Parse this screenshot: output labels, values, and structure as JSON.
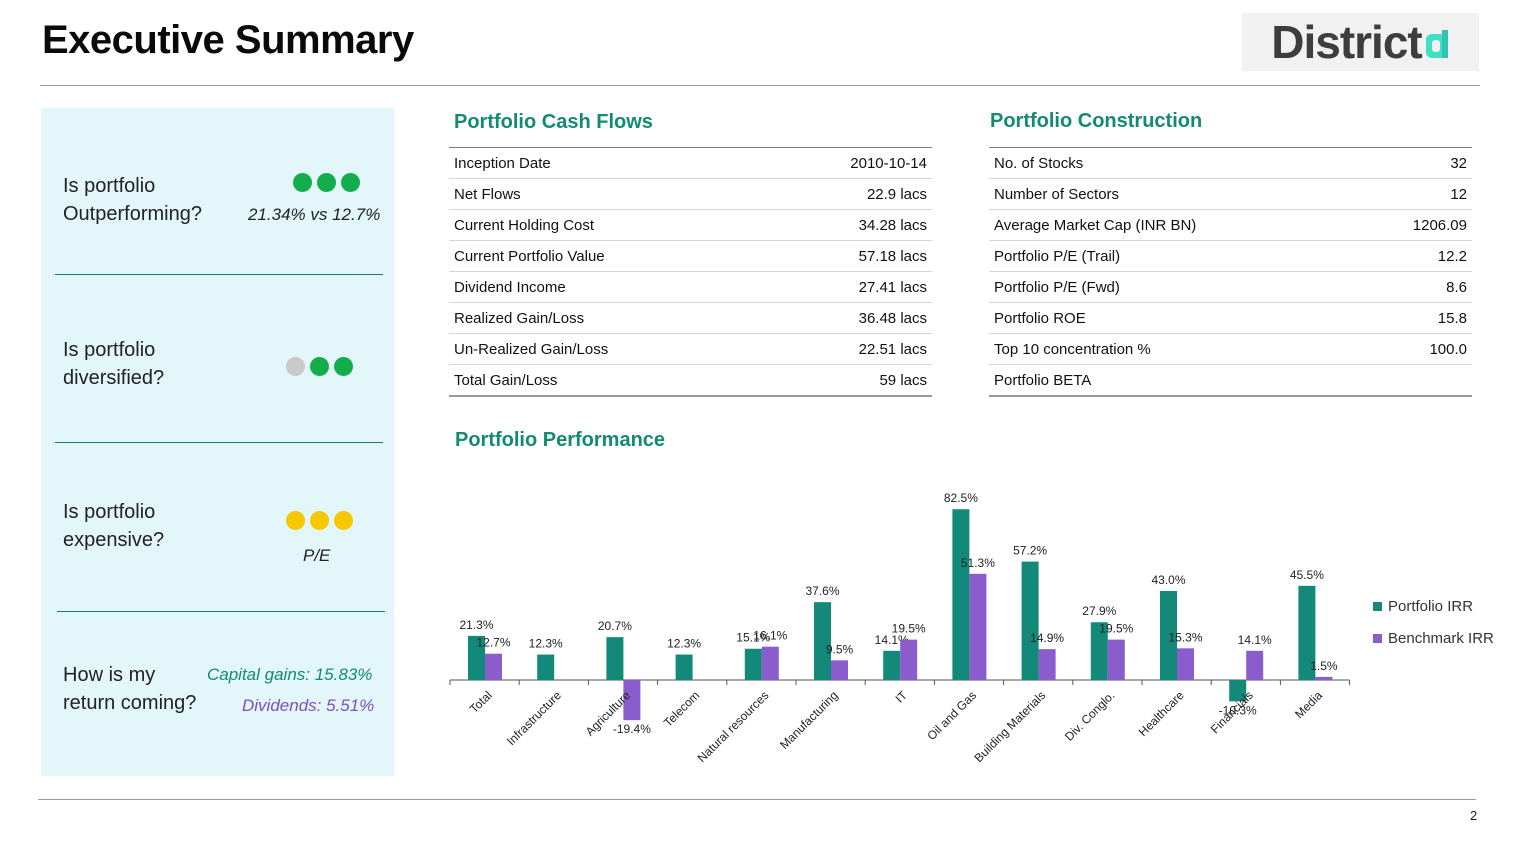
{
  "header": {
    "title": "Executive Summary",
    "logo_text": "District",
    "page_number": "2"
  },
  "colors": {
    "accent": "#138a73",
    "portfolio": "#13897a",
    "benchmark": "#8a5ccc",
    "dot_green": "#14ad4c",
    "dot_grey": "#c9c9c9",
    "dot_yellow": "#f5c802",
    "panel_bg": "#e3f6fa"
  },
  "summary": {
    "outperforming": {
      "question": "Is portfolio Outperforming?",
      "rating": [
        "green",
        "green",
        "green"
      ],
      "note": "21.34% vs 12.7%"
    },
    "diversified": {
      "question": "Is portfolio diversified?",
      "rating": [
        "grey",
        "green",
        "green"
      ]
    },
    "expensive": {
      "question": "Is portfolio expensive?",
      "rating": [
        "yellow",
        "yellow",
        "yellow"
      ],
      "note": "P/E"
    },
    "returns": {
      "question": "How is my return coming?",
      "capital_gains": "Capital gains: 15.83%",
      "dividends": "Dividends: 5.51%"
    }
  },
  "cash_flows": {
    "title": "Portfolio Cash Flows",
    "rows": [
      {
        "label": "Inception Date",
        "value": "2010-10-14"
      },
      {
        "label": "Net Flows",
        "value": "22.9 lacs"
      },
      {
        "label": "Current Holding Cost",
        "value": "34.28 lacs"
      },
      {
        "label": "Current Portfolio Value",
        "value": "57.18 lacs"
      },
      {
        "label": "Dividend Income",
        "value": "27.41 lacs"
      },
      {
        "label": "Realized Gain/Loss",
        "value": "36.48 lacs"
      },
      {
        "label": "Un-Realized Gain/Loss",
        "value": "22.51 lacs"
      },
      {
        "label": "Total Gain/Loss",
        "value": "59 lacs"
      }
    ]
  },
  "construction": {
    "title": "Portfolio Construction",
    "rows": [
      {
        "label": "No. of Stocks",
        "value": "32"
      },
      {
        "label": "Number of Sectors",
        "value": "12"
      },
      {
        "label": "Average Market Cap (INR BN)",
        "value": "1206.09"
      },
      {
        "label": "Portfolio P/E (Trail)",
        "value": "12.2"
      },
      {
        "label": "Portfolio P/E (Fwd)",
        "value": "8.6"
      },
      {
        "label": "Portfolio ROE",
        "value": "15.8"
      },
      {
        "label": "Top 10 concentration %",
        "value": "100.0"
      },
      {
        "label": "Portfolio BETA",
        "value": ""
      }
    ]
  },
  "performance": {
    "title": "Portfolio Performance"
  },
  "chart_data": {
    "type": "bar",
    "categories": [
      "Total",
      "Infrastructure",
      "Agriculture",
      "Telecom",
      "Natural resources",
      "Manufacturing",
      "IT",
      "Oil and Gas",
      "Building Materials",
      "Div. Conglo.",
      "Healthcare",
      "Financials",
      "Media"
    ],
    "series": [
      {
        "name": "Portfolio IRR",
        "values": [
          21.3,
          12.3,
          20.7,
          12.3,
          15.1,
          37.6,
          14.1,
          82.5,
          57.2,
          27.9,
          43.0,
          -10.3,
          45.5
        ],
        "labels": [
          "21.3%",
          "12.3%",
          "20.7%",
          "12.3%",
          "15.1%",
          "37.6%",
          "14.1%",
          "82.5%",
          "57.2%",
          "27.9%",
          "43.0%",
          "-10.3%",
          "45.5%"
        ]
      },
      {
        "name": "Benchmark IRR",
        "values": [
          12.7,
          null,
          -19.4,
          null,
          16.1,
          9.5,
          19.5,
          51.3,
          14.9,
          19.5,
          15.3,
          14.1,
          1.5
        ],
        "labels": [
          "12.7%",
          "",
          "-19.4%",
          "",
          "16.1%",
          "9.5%",
          "19.5%",
          "51.3%",
          "14.9%",
          "19.5%",
          "15.3%",
          "14.1%",
          "1.5%"
        ]
      }
    ],
    "legend": "right",
    "grid": false
  }
}
